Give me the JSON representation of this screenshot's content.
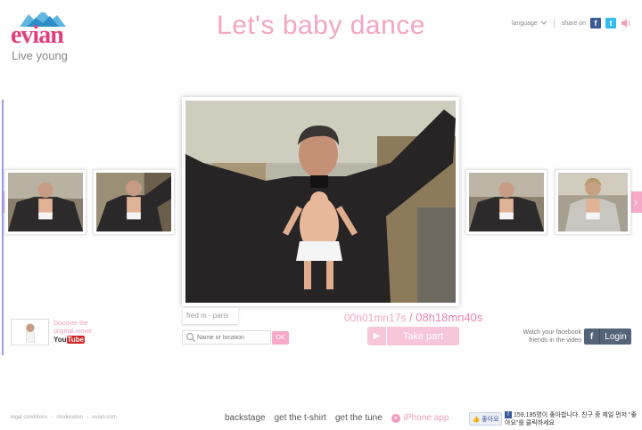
{
  "header": {
    "brand": "evian",
    "tagline": "Live young",
    "title": "Let's baby dance",
    "language_label": "language",
    "share_label": "share on"
  },
  "player": {
    "caption": "fred m - paris",
    "elapsed": "00h01mn17s",
    "separator": " / ",
    "total": "08h18mn40s"
  },
  "search": {
    "placeholder": "Name or location",
    "ok_label": "OK"
  },
  "take_part": {
    "label": "Take part"
  },
  "original_movie": {
    "text": "Discover the original movie",
    "you": "You",
    "tube": "Tube"
  },
  "facebook": {
    "watch_text": "Watch your facebook friends in the video",
    "login_label": "Login",
    "like_label": "좋아요",
    "like_count_text": "159,195명이 좋아합니다. 친구 중 제일 먼저 \"좋아요\"를 클릭하세요"
  },
  "footer": {
    "legal": [
      "legal conditions",
      "moderation",
      "evian.com"
    ],
    "nav": [
      "backstage",
      "get the t-shirt",
      "get the tune"
    ],
    "iphone_label": "iPhone app"
  },
  "colors": {
    "brand_pink": "#e0407a",
    "accent_pink": "#f6a9c8",
    "facebook_blue": "#3b5998",
    "twitter_blue": "#33bbee"
  },
  "icons": [
    "mountains-logo-icon",
    "chevron-down-icon",
    "facebook-icon",
    "twitter-icon",
    "speaker-icon",
    "search-icon",
    "play-icon",
    "chevron-left-icon",
    "chevron-right-icon",
    "like-thumb-icon"
  ]
}
